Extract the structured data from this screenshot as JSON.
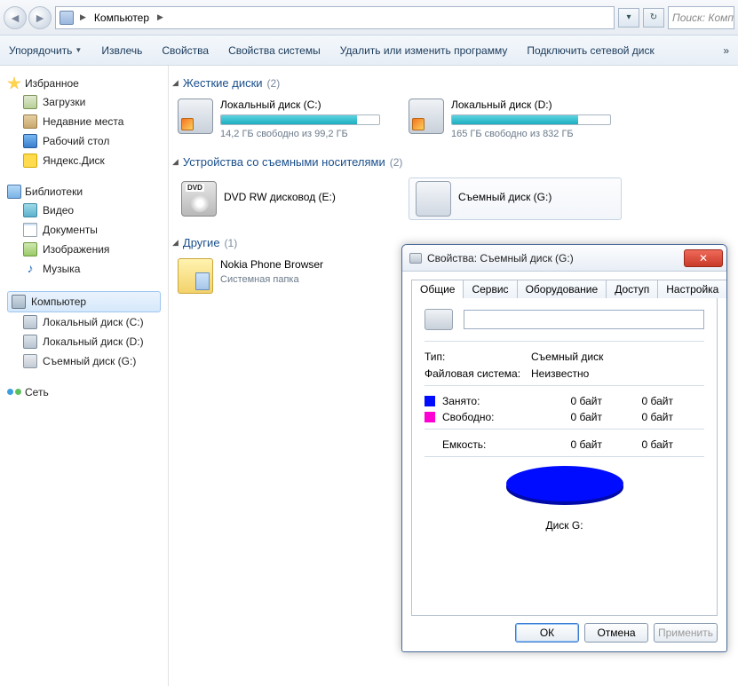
{
  "nav": {
    "crumb1": "Компьютер",
    "search_placeholder": "Поиск: Компьютер"
  },
  "toolbar": {
    "organize": "Упорядочить",
    "extract": "Извлечь",
    "properties": "Свойства",
    "sysprops": "Свойства системы",
    "uninstall": "Удалить или изменить программу",
    "mapdrive": "Подключить сетевой диск",
    "more": "»"
  },
  "sidebar": {
    "favorites": "Избранное",
    "downloads": "Загрузки",
    "recent": "Недавние места",
    "desktop": "Рабочий стол",
    "yadisk": "Яндекс.Диск",
    "libraries": "Библиотеки",
    "video": "Видео",
    "documents": "Документы",
    "images": "Изображения",
    "music": "Музыка",
    "computer": "Компьютер",
    "ldc": "Локальный диск (C:)",
    "ldd": "Локальный диск (D:)",
    "usbg": "Съемный диск (G:)",
    "network": "Сеть"
  },
  "groups": {
    "hdd": {
      "title": "Жесткие диски",
      "count": "(2)"
    },
    "removable": {
      "title": "Устройства со съемными носителями",
      "count": "(2)"
    },
    "other": {
      "title": "Другие",
      "count": "(1)"
    }
  },
  "drives": {
    "c": {
      "name": "Локальный диск (C:)",
      "free": "14,2 ГБ свободно из 99,2 ГБ",
      "pct": 86
    },
    "d": {
      "name": "Локальный диск (D:)",
      "free": "165 ГБ свободно из 832 ГБ",
      "pct": 80
    },
    "dvd": {
      "name": "DVD RW дисковод (E:)"
    },
    "usb": {
      "name": "Съемный диск (G:)"
    },
    "nokia": {
      "name": "Nokia Phone Browser",
      "sub": "Системная папка"
    }
  },
  "dialog": {
    "title": "Свойства: Съемный диск (G:)",
    "tabs": {
      "general": "Общие",
      "service": "Сервис",
      "hardware": "Оборудование",
      "access": "Доступ",
      "settings": "Настройка"
    },
    "label_value": "",
    "type_k": "Тип:",
    "type_v": "Съемный диск",
    "fs_k": "Файловая система:",
    "fs_v": "Неизвестно",
    "used": "Занято:",
    "used_v1": "0 байт",
    "used_v2": "0 байт",
    "free": "Свободно:",
    "free_v1": "0 байт",
    "free_v2": "0 байт",
    "cap": "Емкость:",
    "cap_v1": "0 байт",
    "cap_v2": "0 байт",
    "disklabel": "Диск G:",
    "ok": "ОК",
    "cancel": "Отмена",
    "apply": "Применить"
  }
}
